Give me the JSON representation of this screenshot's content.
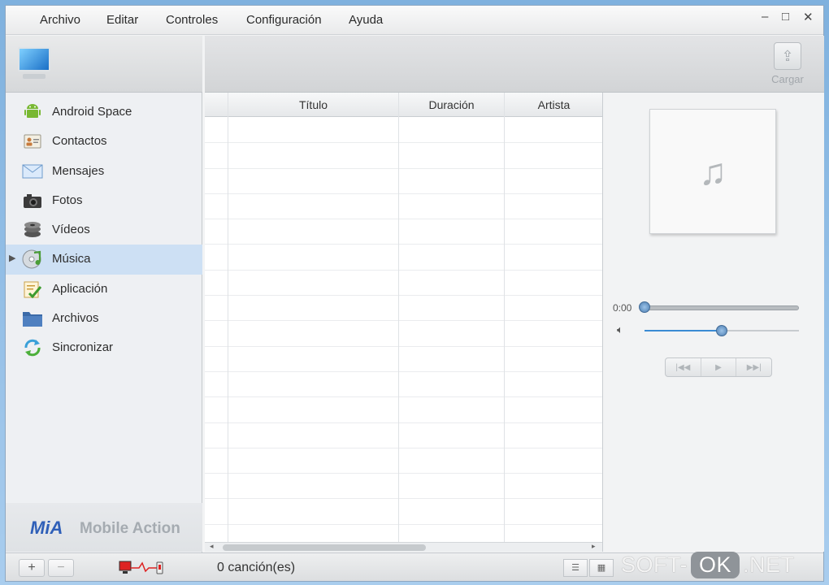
{
  "menu": {
    "items": [
      "Archivo",
      "Editar",
      "Controles",
      "Configuración",
      "Ayuda"
    ],
    "window_controls": {
      "minimize": "–",
      "maximize": "□",
      "close": "✕"
    }
  },
  "sidebar": {
    "header_icon": "computer-monitor-icon",
    "items": [
      {
        "label": "Android Space",
        "icon": "android-icon"
      },
      {
        "label": "Contactos",
        "icon": "contact-card-icon"
      },
      {
        "label": "Mensajes",
        "icon": "envelope-icon"
      },
      {
        "label": "Fotos",
        "icon": "camera-icon"
      },
      {
        "label": "Vídeos",
        "icon": "film-reel-icon"
      },
      {
        "label": "Música",
        "icon": "music-cd-icon",
        "selected": true
      },
      {
        "label": "Aplicación",
        "icon": "checklist-icon"
      },
      {
        "label": "Archivos",
        "icon": "folder-icon"
      },
      {
        "label": "Sincronizar",
        "icon": "sync-icon"
      }
    ],
    "brand": {
      "logo": "MiA",
      "name": "Mobile Action"
    }
  },
  "toolbar": {
    "load_label": "Cargar",
    "load_icon": "upload-icon"
  },
  "table": {
    "columns": [
      "Título",
      "Duración",
      "Artista"
    ],
    "rows": []
  },
  "player": {
    "art_icon": "music-note-icon",
    "time": "0:00",
    "seek": 0,
    "volume": 0.5,
    "controls": [
      "previous-icon",
      "play-icon",
      "next-icon"
    ]
  },
  "status": {
    "add_label": "+",
    "remove_label": "−",
    "song_count": "0 canción(es)"
  },
  "watermark": {
    "left": "SOFT-",
    "middle": "OK",
    "right": ".NET"
  },
  "colors": {
    "selection": "#cde0f4",
    "accent": "#3a8bd4"
  }
}
